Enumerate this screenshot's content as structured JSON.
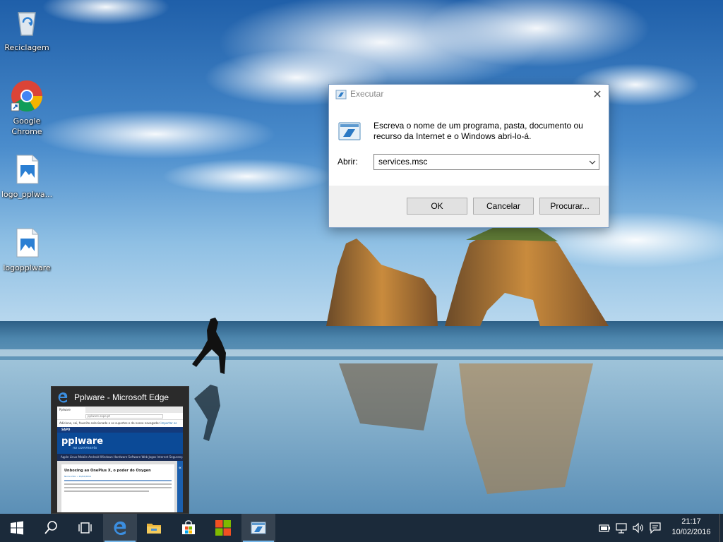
{
  "desktop": {
    "icons": [
      {
        "label": "Reciclagem",
        "icon": "recycle-bin-icon"
      },
      {
        "label": "Google Chrome",
        "icon": "chrome-icon"
      },
      {
        "label": "logo_pplwa...",
        "icon": "image-file-icon"
      },
      {
        "label": "logopplware",
        "icon": "image-file-icon"
      }
    ]
  },
  "run_dialog": {
    "title": "Executar",
    "description": "Escreva o nome de um programa, pasta, documento ou recurso da Internet e o Windows abri-lo-á.",
    "open_label": "Abrir:",
    "open_value": "services.msc",
    "buttons": {
      "ok": "OK",
      "cancel": "Cancelar",
      "browse": "Procurar..."
    }
  },
  "edge_thumbnail": {
    "title": "Pplware - Microsoft Edge",
    "preview": {
      "tab1": "Pplware",
      "tab2": "",
      "address": "pplware.sapo.pt",
      "notice": "Adicione, sai, favorito selecionado e os suportes e do nosso navegador",
      "notice_link": "importar os seus favoritos",
      "strip_label": "SAPO",
      "logo": "pplware",
      "tagline": "no comments",
      "nav": "Apple  Linux  Mobile  Android  Windows  Hardware  Software  Web  Jogos  Internet  Segurança",
      "headline": "Unboxing ao OnePlus X, o poder do Oxygen",
      "meta": "Nome Vitor • 10/02/2016",
      "side_glyph": "«"
    }
  },
  "taskbar": {
    "buttons": [
      {
        "name": "start-button",
        "icon": "windows-logo-icon"
      },
      {
        "name": "search-button",
        "icon": "search-icon"
      },
      {
        "name": "task-view-button",
        "icon": "task-view-icon"
      },
      {
        "name": "edge-taskbar-button",
        "icon": "edge-icon"
      },
      {
        "name": "file-explorer-taskbar-button",
        "icon": "folder-icon"
      },
      {
        "name": "store-taskbar-button",
        "icon": "store-icon"
      },
      {
        "name": "office-taskbar-button",
        "icon": "office-icon"
      },
      {
        "name": "run-taskbar-button",
        "icon": "run-icon"
      }
    ],
    "tray": [
      "battery-icon",
      "network-icon",
      "volume-icon",
      "action-center-icon"
    ],
    "clock": {
      "time": "21:17",
      "date": "10/02/2016"
    }
  },
  "colors": {
    "taskbar": "#1b2a3a",
    "accent": "#76b9ed",
    "dialog_footer": "#f0f0f0"
  }
}
